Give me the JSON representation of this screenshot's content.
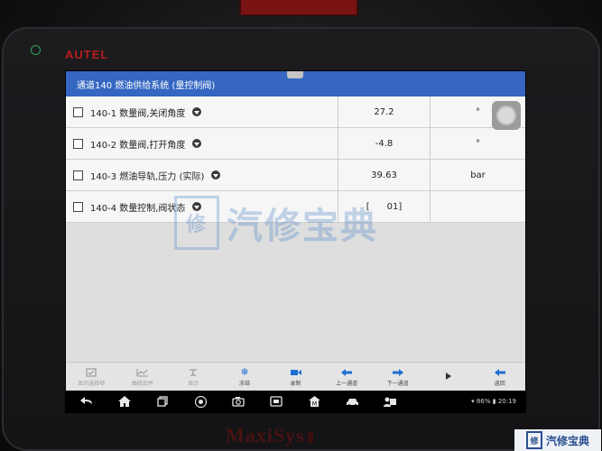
{
  "brand": "AUTEL",
  "device_name": "MaxiSys",
  "device_badge": "",
  "window": {
    "title": "通道140 燃油供给系统 (量控制阀)"
  },
  "rows": [
    {
      "name": "140-1 数量阀,关闭角度",
      "value": "27.2",
      "unit": "°"
    },
    {
      "name": "140-2 数量阀,打开角度",
      "value": "-4.8",
      "unit": "°"
    },
    {
      "name": "140-3 燃油导轨,压力 (实际)",
      "value": "39.63",
      "unit": "bar"
    },
    {
      "name": "140-4 数量控制,阀状态",
      "value": "[      01]",
      "unit": ""
    }
  ],
  "toolbar": [
    {
      "label": "显示选择项",
      "icon": "checkbox-icon",
      "disabled": true
    },
    {
      "label": "曲线合并",
      "icon": "graph-icon",
      "disabled": true
    },
    {
      "label": "显示",
      "icon": "display-icon",
      "disabled": true
    },
    {
      "label": "冻结",
      "icon": "snowflake-icon",
      "disabled": false
    },
    {
      "label": "录制",
      "icon": "record-icon",
      "disabled": false
    },
    {
      "label": "上一通道",
      "icon": "arrow-left-icon",
      "disabled": false
    },
    {
      "label": "下一通道",
      "icon": "arrow-right-icon",
      "disabled": false
    },
    {
      "label": "",
      "icon": "play-icon",
      "disabled": false
    },
    {
      "label": "返回",
      "icon": "back-arrow-icon",
      "disabled": false
    }
  ],
  "status_bar": {
    "battery": "86%",
    "time": "20:19"
  },
  "watermark": {
    "text": "汽修宝典",
    "badge": "修"
  },
  "corner_logo": {
    "text": "汽修宝典",
    "badge": "修"
  },
  "colors": {
    "title_bar": "#3466c2",
    "brand": "#b51d1d",
    "accent_blue": "#1f6fd1"
  }
}
